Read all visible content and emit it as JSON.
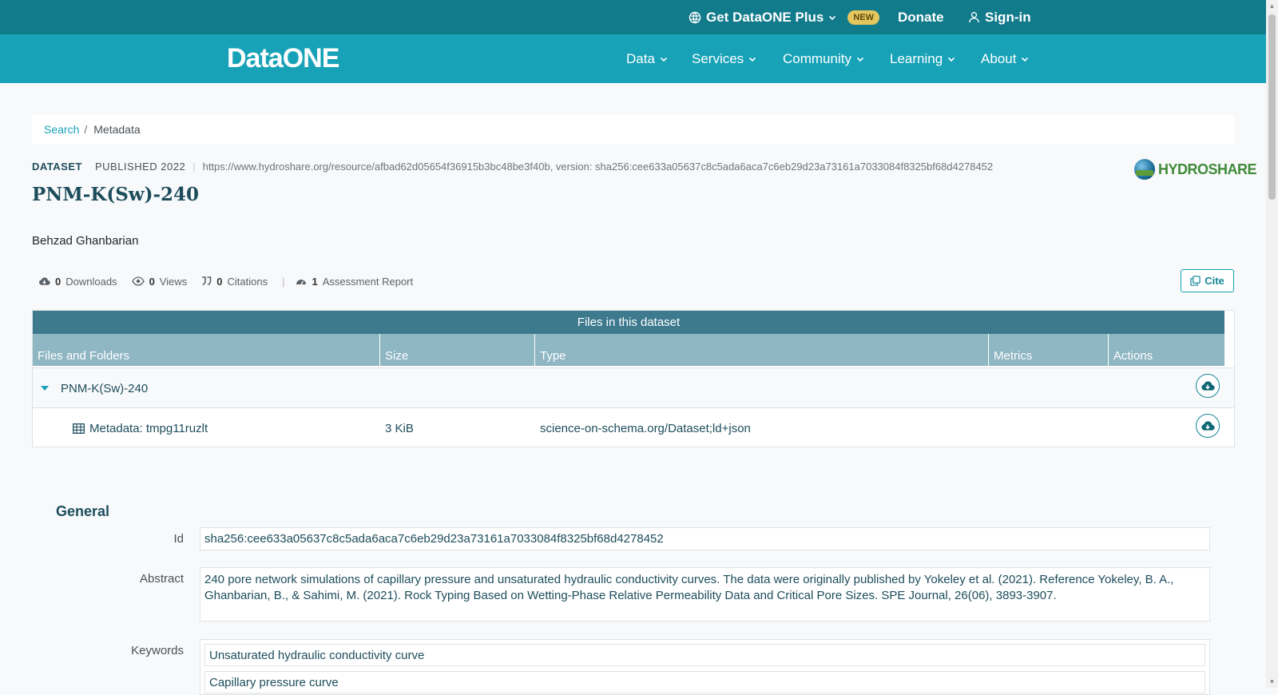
{
  "topbar": {
    "plus_label": "Get DataONE Plus",
    "badge": "NEW",
    "donate": "Donate",
    "signin": "Sign-in"
  },
  "nav": {
    "logo": "DataONE",
    "items": [
      {
        "label": "Data"
      },
      {
        "label": "Services"
      },
      {
        "label": "Community"
      },
      {
        "label": "Learning"
      },
      {
        "label": "About"
      }
    ]
  },
  "breadcrumb": {
    "search": "Search",
    "sep": "/",
    "current": "Metadata"
  },
  "dataset": {
    "type": "DATASET",
    "published": "PUBLISHED 2022",
    "identifier": "https://www.hydroshare.org/resource/afbad62d05654f36915b3bc48be3f40b, version: sha256:cee633a05637c8c5ada6aca7c6eb29d23a73161a7033084f8325bf68d4278452",
    "repository": "HYDROSHARE",
    "title": "PNM-K(Sw)-240",
    "author": "Behzad Ghanbarian"
  },
  "stats": {
    "downloads_count": "0",
    "downloads_label": "Downloads",
    "views_count": "0",
    "views_label": "Views",
    "citations_count": "0",
    "citations_label": "Citations",
    "assessment_count": "1",
    "assessment_label": "Assessment Report",
    "cite_button": "Cite"
  },
  "files": {
    "heading": "Files in this dataset",
    "columns": [
      "Files and Folders",
      "Size",
      "Type",
      "Metrics",
      "Actions"
    ],
    "rows": [
      {
        "name": "PNM-K(Sw)-240",
        "size": "",
        "type": ""
      },
      {
        "name": "Metadata: tmpg11ruzlt",
        "size": "3 KiB",
        "type": "science-on-schema.org/Dataset;ld+json"
      }
    ]
  },
  "general": {
    "heading": "General",
    "id_label": "Id",
    "id_value": "sha256:cee633a05637c8c5ada6aca7c6eb29d23a73161a7033084f8325bf68d4278452",
    "abstract_label": "Abstract",
    "abstract_value": "240 pore network simulations of capillary pressure and unsaturated hydraulic conductivity curves. The data were originally published by Yokeley et al. (2021). Reference Yokeley, B. A., Ghanbarian, B., & Sahimi, M. (2021). Rock Typing Based on Wetting-Phase Relative Permeability Data and Critical Pore Sizes. SPE Journal, 26(06), 3893-3907.",
    "keywords_label": "Keywords",
    "keywords": [
      "Unsaturated hydraulic conductivity curve",
      "Capillary pressure curve"
    ]
  },
  "colors": {
    "topbar": "#117a8b",
    "navbar": "#17a2b8",
    "files_header": "#3d7a8e",
    "columns_header": "#8fb6c3",
    "title": "#1d4d5c"
  }
}
